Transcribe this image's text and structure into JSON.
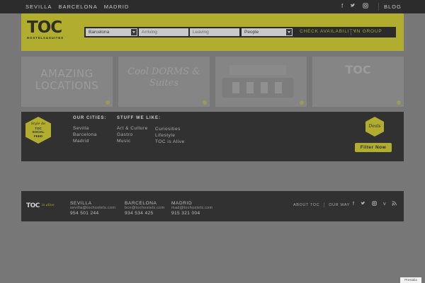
{
  "topnav": {
    "cities": [
      "SEVILLA",
      "BARCELONA",
      "MADRID"
    ],
    "social_icons": [
      "facebook-icon",
      "twitter-icon",
      "instagram-icon"
    ],
    "blog": "BLOG"
  },
  "header": {
    "logo": "TOC",
    "logo_sub": "HOSTELS&SUITES",
    "booking": {
      "city": "Barcelona",
      "arriving_placeholder": "Arriving",
      "leaving_placeholder": "Leaving",
      "people": "People",
      "check_availability": "CHECK AVAILABILITY",
      "in_group": "IN GROUP"
    }
  },
  "tiles": [
    {
      "caption": "AMAZING LOCATIONS"
    },
    {
      "caption": "Cool DORMS & Suites"
    },
    {
      "caption": ""
    },
    {
      "caption": "TOC"
    }
  ],
  "panel": {
    "hex_social": {
      "line1": "Style de",
      "line2": "TOC",
      "line3": "SOCIAL",
      "line4": "FEED"
    },
    "cities_heading": "OUR CITIES:",
    "cities": [
      "Sevilla",
      "Barcelona",
      "Madrid"
    ],
    "stuff_heading": "STUFF WE LIKE:",
    "stuff_col1": [
      "Art & Culture",
      "Gastro",
      "Music"
    ],
    "stuff_col2": [
      "Curiosities",
      "Lifestyle",
      "TOC is Alive"
    ],
    "hex_deals": "Deals",
    "filter_button": "Filter Now"
  },
  "footer": {
    "logo": "TOC",
    "logo_script": "is alive",
    "offices": [
      {
        "city": "SEVILLA",
        "email": "sevilla@tochostels.com",
        "phone": "954 501 244"
      },
      {
        "city": "BARCELONA",
        "email": "bcn@tochostels.com",
        "phone": "934 534 425"
      },
      {
        "city": "MADRID",
        "email": "mad@tochostels.com",
        "phone": "915 321 004"
      }
    ],
    "links": [
      "ABOUT TOC",
      "OUR WAY"
    ],
    "social_icons": [
      "facebook-icon",
      "twitter-icon",
      "instagram-icon",
      "vine-icon",
      "rss-icon"
    ]
  },
  "badge": "Prestalia"
}
